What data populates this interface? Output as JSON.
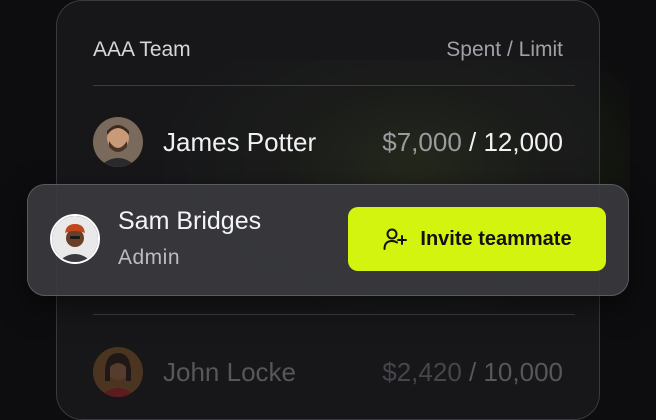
{
  "colors": {
    "accent": "#d3f40f",
    "background": "#0d0d0f",
    "card": "#1c1c1e"
  },
  "card": {
    "title": "AAA Team",
    "column_label": "Spent / Limit"
  },
  "members": [
    {
      "name": "James Potter",
      "spent": "$7,000",
      "limit": " / 12,000"
    },
    {
      "name": "John Locke",
      "spent": "$2,420",
      "limit": " / 10,000"
    }
  ],
  "popup": {
    "name": "Sam Bridges",
    "role": "Admin",
    "invite_label": "Invite teammate",
    "invite_icon": "user-plus-icon"
  }
}
